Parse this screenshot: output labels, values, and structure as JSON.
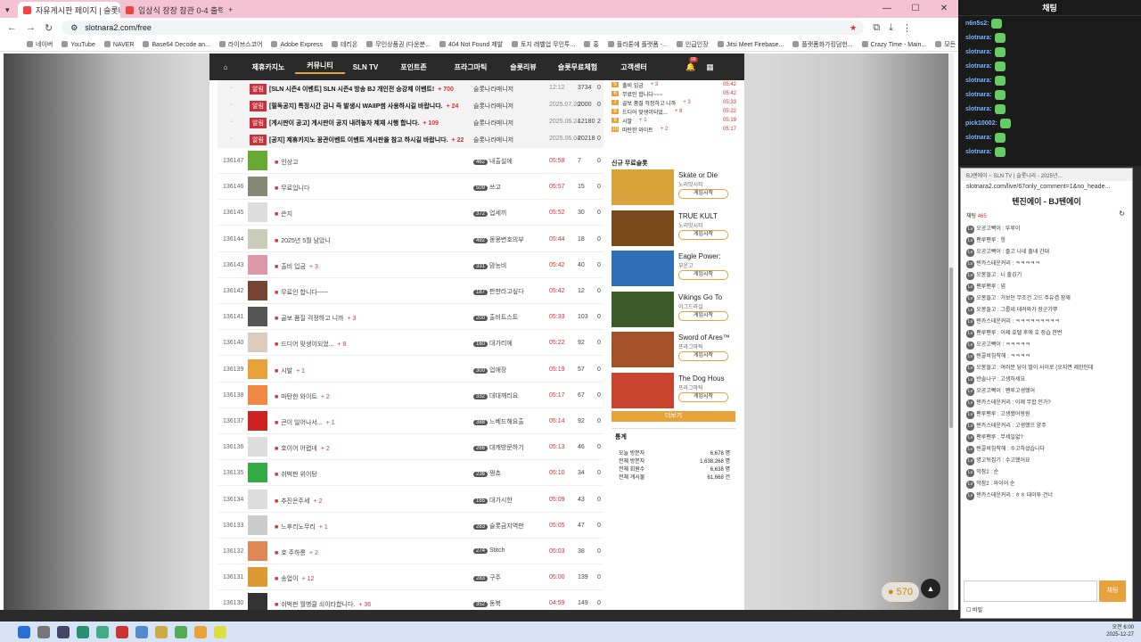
{
  "browser": {
    "tabs": [
      {
        "label": "자유게시판 페이지 | 슬롯나라",
        "active": true
      },
      {
        "label": "입상식 장장 참관 0-4 출력",
        "active": false
      }
    ],
    "url": "slotnara2.com/free",
    "bookmarks": [
      "네이버",
      "YouTube",
      "NAVER",
      "Base64 Decode an...",
      "라이브스코어",
      "Adobe Express",
      "테리온",
      "무인상품권 (다운분...",
      "404 Not Found 제발",
      "토지 레벨업 무인투...",
      "홍",
      "플라톤에 플랫폼 -...",
      "인급인장",
      "Jitsi Meet Firebase...",
      "플랫폼화가킹덤헌...",
      "Crazy Time - Main...",
      "모든 북마크"
    ]
  },
  "site": {
    "nav": [
      "⌂",
      "제휴카지노",
      "커뮤니티",
      "SLN TV",
      "포인트존",
      "프라그마틱",
      "슬롯리뷰",
      "슬롯무료체험",
      "고객센터"
    ],
    "nav_active": 2,
    "bell_count": "99"
  },
  "board": {
    "notices": [
      {
        "badge": "알림",
        "title": "[SLN 시즌4 이벤트] SLN 시즌4 방송 BJ 개인전 승강제 이벤트!",
        "cmt": "+ 700",
        "author": "슬롯나라매니저",
        "time": "12:12",
        "hits": "3734",
        "rec": "0"
      },
      {
        "badge": "알림",
        "title": "[필독공지] 특정시간 금니 즉 발생시 WAIIP썸 사용하시길 바랍니다.",
        "cmt": "+ 24",
        "author": "슬롯나라매니저",
        "time": "2025.07.20",
        "hits": "2000",
        "rec": "0"
      },
      {
        "badge": "알림",
        "title": "[게시판이 공고] 게시판이 공지 내려놓자 제재 시행 합니다.",
        "cmt": "+ 109",
        "author": "슬롯나라매니저",
        "time": "2025.06.24",
        "hits": "12180",
        "rec": "2"
      },
      {
        "badge": "알림",
        "title": "[공지] 제휴카지노 꽁관이벤트 이벤트 게시판을 참고 하시길 바랍니다.",
        "cmt": "+ 22",
        "author": "슬롯나라매니저",
        "time": "2025.06.04",
        "hits": "20218",
        "rec": "0"
      }
    ],
    "posts": [
      {
        "no": "136147",
        "title": "인상고",
        "cmt": "",
        "lvl": "462",
        "author": "내출설에",
        "time": "05:58",
        "hits": "7",
        "rec": "0"
      },
      {
        "no": "136146",
        "title": "무료입니다",
        "cmt": "",
        "lvl": "509",
        "author": "쓰고",
        "time": "05:57",
        "hits": "15",
        "rec": "0"
      },
      {
        "no": "136145",
        "title": "쓴지",
        "cmt": "",
        "lvl": "372",
        "author": "업세끼",
        "time": "05:52",
        "hits": "30",
        "rec": "0"
      },
      {
        "no": "136144",
        "title": "2025년 5월 남았니",
        "cmt": "",
        "lvl": "492",
        "author": "몽몽변호의부",
        "time": "05:44",
        "hits": "18",
        "rec": "0"
      },
      {
        "no": "136143",
        "title": "출비 입금",
        "cmt": "+ 3",
        "lvl": "331",
        "author": "맘능비",
        "time": "05:42",
        "hits": "40",
        "rec": "0"
      },
      {
        "no": "136142",
        "title": "무료인 합니다~~~",
        "cmt": "",
        "lvl": "187",
        "author": "판판라고싶다",
        "time": "05:42",
        "hits": "12",
        "rec": "0"
      },
      {
        "no": "136141",
        "title": "골보 품질 걱정하고 니까",
        "cmt": "+ 3",
        "lvl": "200",
        "author": "출비트스트",
        "time": "05:33",
        "hits": "103",
        "rec": "0"
      },
      {
        "no": "136140",
        "title": "드디어 맞생이되었...",
        "cmt": "+ 8",
        "lvl": "160",
        "author": "대가리에",
        "time": "05:22",
        "hits": "92",
        "rec": "0"
      },
      {
        "no": "136139",
        "title": "시발",
        "cmt": "+ 1",
        "lvl": "300",
        "author": "업애장",
        "time": "05:19",
        "hits": "57",
        "rec": "0"
      },
      {
        "no": "136138",
        "title": "마탄한 와이트",
        "cmt": "+ 2",
        "lvl": "332",
        "author": "대대깨리요",
        "time": "05:17",
        "hits": "67",
        "rec": "0"
      },
      {
        "no": "136137",
        "title": "큰이 일어나서...",
        "cmt": "+ 1",
        "lvl": "388",
        "author": "느베드해요출",
        "time": "05:14",
        "hits": "92",
        "rec": "0"
      },
      {
        "no": "136136",
        "title": "호이어 어렵네",
        "cmt": "+ 2",
        "lvl": "266",
        "author": "대캐방문하기",
        "time": "05:13",
        "hits": "46",
        "rec": "0"
      },
      {
        "no": "136135",
        "title": "쉬벅판 위이탕",
        "cmt": "",
        "lvl": "236",
        "author": "쩡쵸",
        "time": "05:10",
        "hits": "34",
        "rec": "0"
      },
      {
        "no": "136134",
        "title": "추진은주세",
        "cmt": "+ 2",
        "lvl": "165",
        "author": "대가시한",
        "time": "05:09",
        "hits": "43",
        "rec": "0"
      },
      {
        "no": "136133",
        "title": "느후리노무리",
        "cmt": "+ 1",
        "lvl": "283",
        "author": "슬롯금지역판",
        "time": "05:05",
        "hits": "47",
        "rec": "0"
      },
      {
        "no": "136132",
        "title": "호 주하롱",
        "cmt": "+ 2",
        "lvl": "274",
        "author": "Stitch",
        "time": "05:03",
        "hits": "38",
        "rec": "0"
      },
      {
        "no": "136131",
        "title": "송업이",
        "cmt": "+ 12",
        "lvl": "283",
        "author": "구주",
        "time": "05:00",
        "hits": "139",
        "rec": "0"
      },
      {
        "no": "136130",
        "title": "쉬벅판 월병클 쇠이타합니다.",
        "cmt": "+ 36",
        "lvl": "352",
        "author": "동북",
        "time": "04:59",
        "hits": "149",
        "rec": "0"
      }
    ]
  },
  "sidebar": {
    "ranking": [
      {
        "n": "5",
        "title": "출비 입금",
        "cmt": "+ 3",
        "time": "05:42"
      },
      {
        "n": "6",
        "title": "무료인 합니다~~~",
        "cmt": "",
        "time": "05:42"
      },
      {
        "n": "7",
        "title": "골보 품질 걱정하고 니까",
        "cmt": "+ 3",
        "time": "05:33"
      },
      {
        "n": "8",
        "title": "드디어 맞생이되었...",
        "cmt": "+ 8",
        "time": "05:22"
      },
      {
        "n": "9",
        "title": "시발",
        "cmt": "+ 1",
        "time": "05:19"
      },
      {
        "n": "10",
        "title": "마탄한 와이트",
        "cmt": "+ 2",
        "time": "05:17"
      }
    ],
    "games_title": "신규 무료슬롯",
    "games": [
      {
        "name": "Skate or Die",
        "provider": "노리밋시티",
        "button": "게임시작",
        "color": "#d9a23a"
      },
      {
        "name": "TRUE KULT",
        "provider": "노리밋시티",
        "button": "게임시작",
        "color": "#7a4a1c"
      },
      {
        "name": "Eagle Power:",
        "provider": "부운고",
        "button": "게임시작",
        "color": "#2f6fb7"
      },
      {
        "name": "Vikings Go To",
        "provider": "이그드라실",
        "button": "게임시작",
        "color": "#3c5a2a"
      },
      {
        "name": "Sword of Ares™",
        "provider": "프라그마틱",
        "button": "게임시작",
        "color": "#a4502a"
      },
      {
        "name": "The Dog Hous",
        "provider": "프라그마틱",
        "button": "게임시작",
        "color": "#c8442e"
      }
    ],
    "more": "더보기",
    "stats_title": "통계",
    "stats": [
      {
        "label": "오늘 방문자",
        "value": "6,678 명"
      },
      {
        "label": "전체 방문자",
        "value": "1,638,268 명"
      },
      {
        "label": "전체 회원수",
        "value": "6,638 명"
      },
      {
        "label": "전체 게시물",
        "value": "61,668 건"
      }
    ]
  },
  "fab": {
    "points": "570"
  },
  "chat": {
    "title": "채팅",
    "lines": [
      {
        "name": "n6n5s2:"
      },
      {
        "name": "slotnara:"
      },
      {
        "name": "slotnara:"
      },
      {
        "name": "slotnara:"
      },
      {
        "name": "slotnara:"
      },
      {
        "name": "slotnara:"
      },
      {
        "name": "slotnara:"
      },
      {
        "name": "pick10002:"
      },
      {
        "name": "slotnara:"
      },
      {
        "name": "slotnara:"
      }
    ]
  },
  "popup": {
    "window_title": "BJ랜에이 ~ SLN TV | 슬롯나라 - 2025년...",
    "url": "slotnara2.com/live/67only_comment=1&no_heade...",
    "title": "텐진에이 - BJ텐에이",
    "count_label": "채팅",
    "count": "465",
    "messages": [
      "오공고빡이 : 뚜루이",
      "팬루팬루 : 힝",
      "오공고빡이 : 졸고 나네 출네 간대",
      "텐카스테운커리 : ㅋㅋㅋㅋㅋ",
      "오봉들고 : 니 출깅기",
      "팬루팬루 : 넵",
      "오봉들고 : 거보던 무조건 고드 주유겸 장깨",
      "오봉들고 : 그룹네 데려와가 장군가뿌",
      "텐카스테운커리 : ㅋㅋㅋㅋㅋㅋㅋㅋㅋ",
      "팬루팬루 : 어제 호텔 후에 호 장습 한번",
      "오공고빡이 : ㅋㅋㅋㅋㅋ",
      "텐콜비침착해 : ㅋㅋㅋㅋ",
      "오봉들고 : 여러분 당이 벌이 사이로 (오지면 제한인데",
      "반솔나구 : 고생하세요",
      "오공고빡이 : 팬루고생했어",
      "텐카스테운커리 : 이제 무합 인가?",
      "팬루팬루 : 고생했어왕원",
      "텐카스테운커리 : 고생했으 양주",
      "팬루팬루 : 무세일없?",
      "텐콜비침착해 : 수고하셨습니다",
      "명고뒤집기 : 수고했어요",
      "막참2 : 순",
      "막참2 : 와이어 순",
      "텐카스테운커리 : ㅎㅎ 대이투 건너"
    ],
    "send": "채팅",
    "footer": "비밀"
  },
  "taskbar": {
    "time": "오전 6:00",
    "date": "2025-12-27"
  }
}
